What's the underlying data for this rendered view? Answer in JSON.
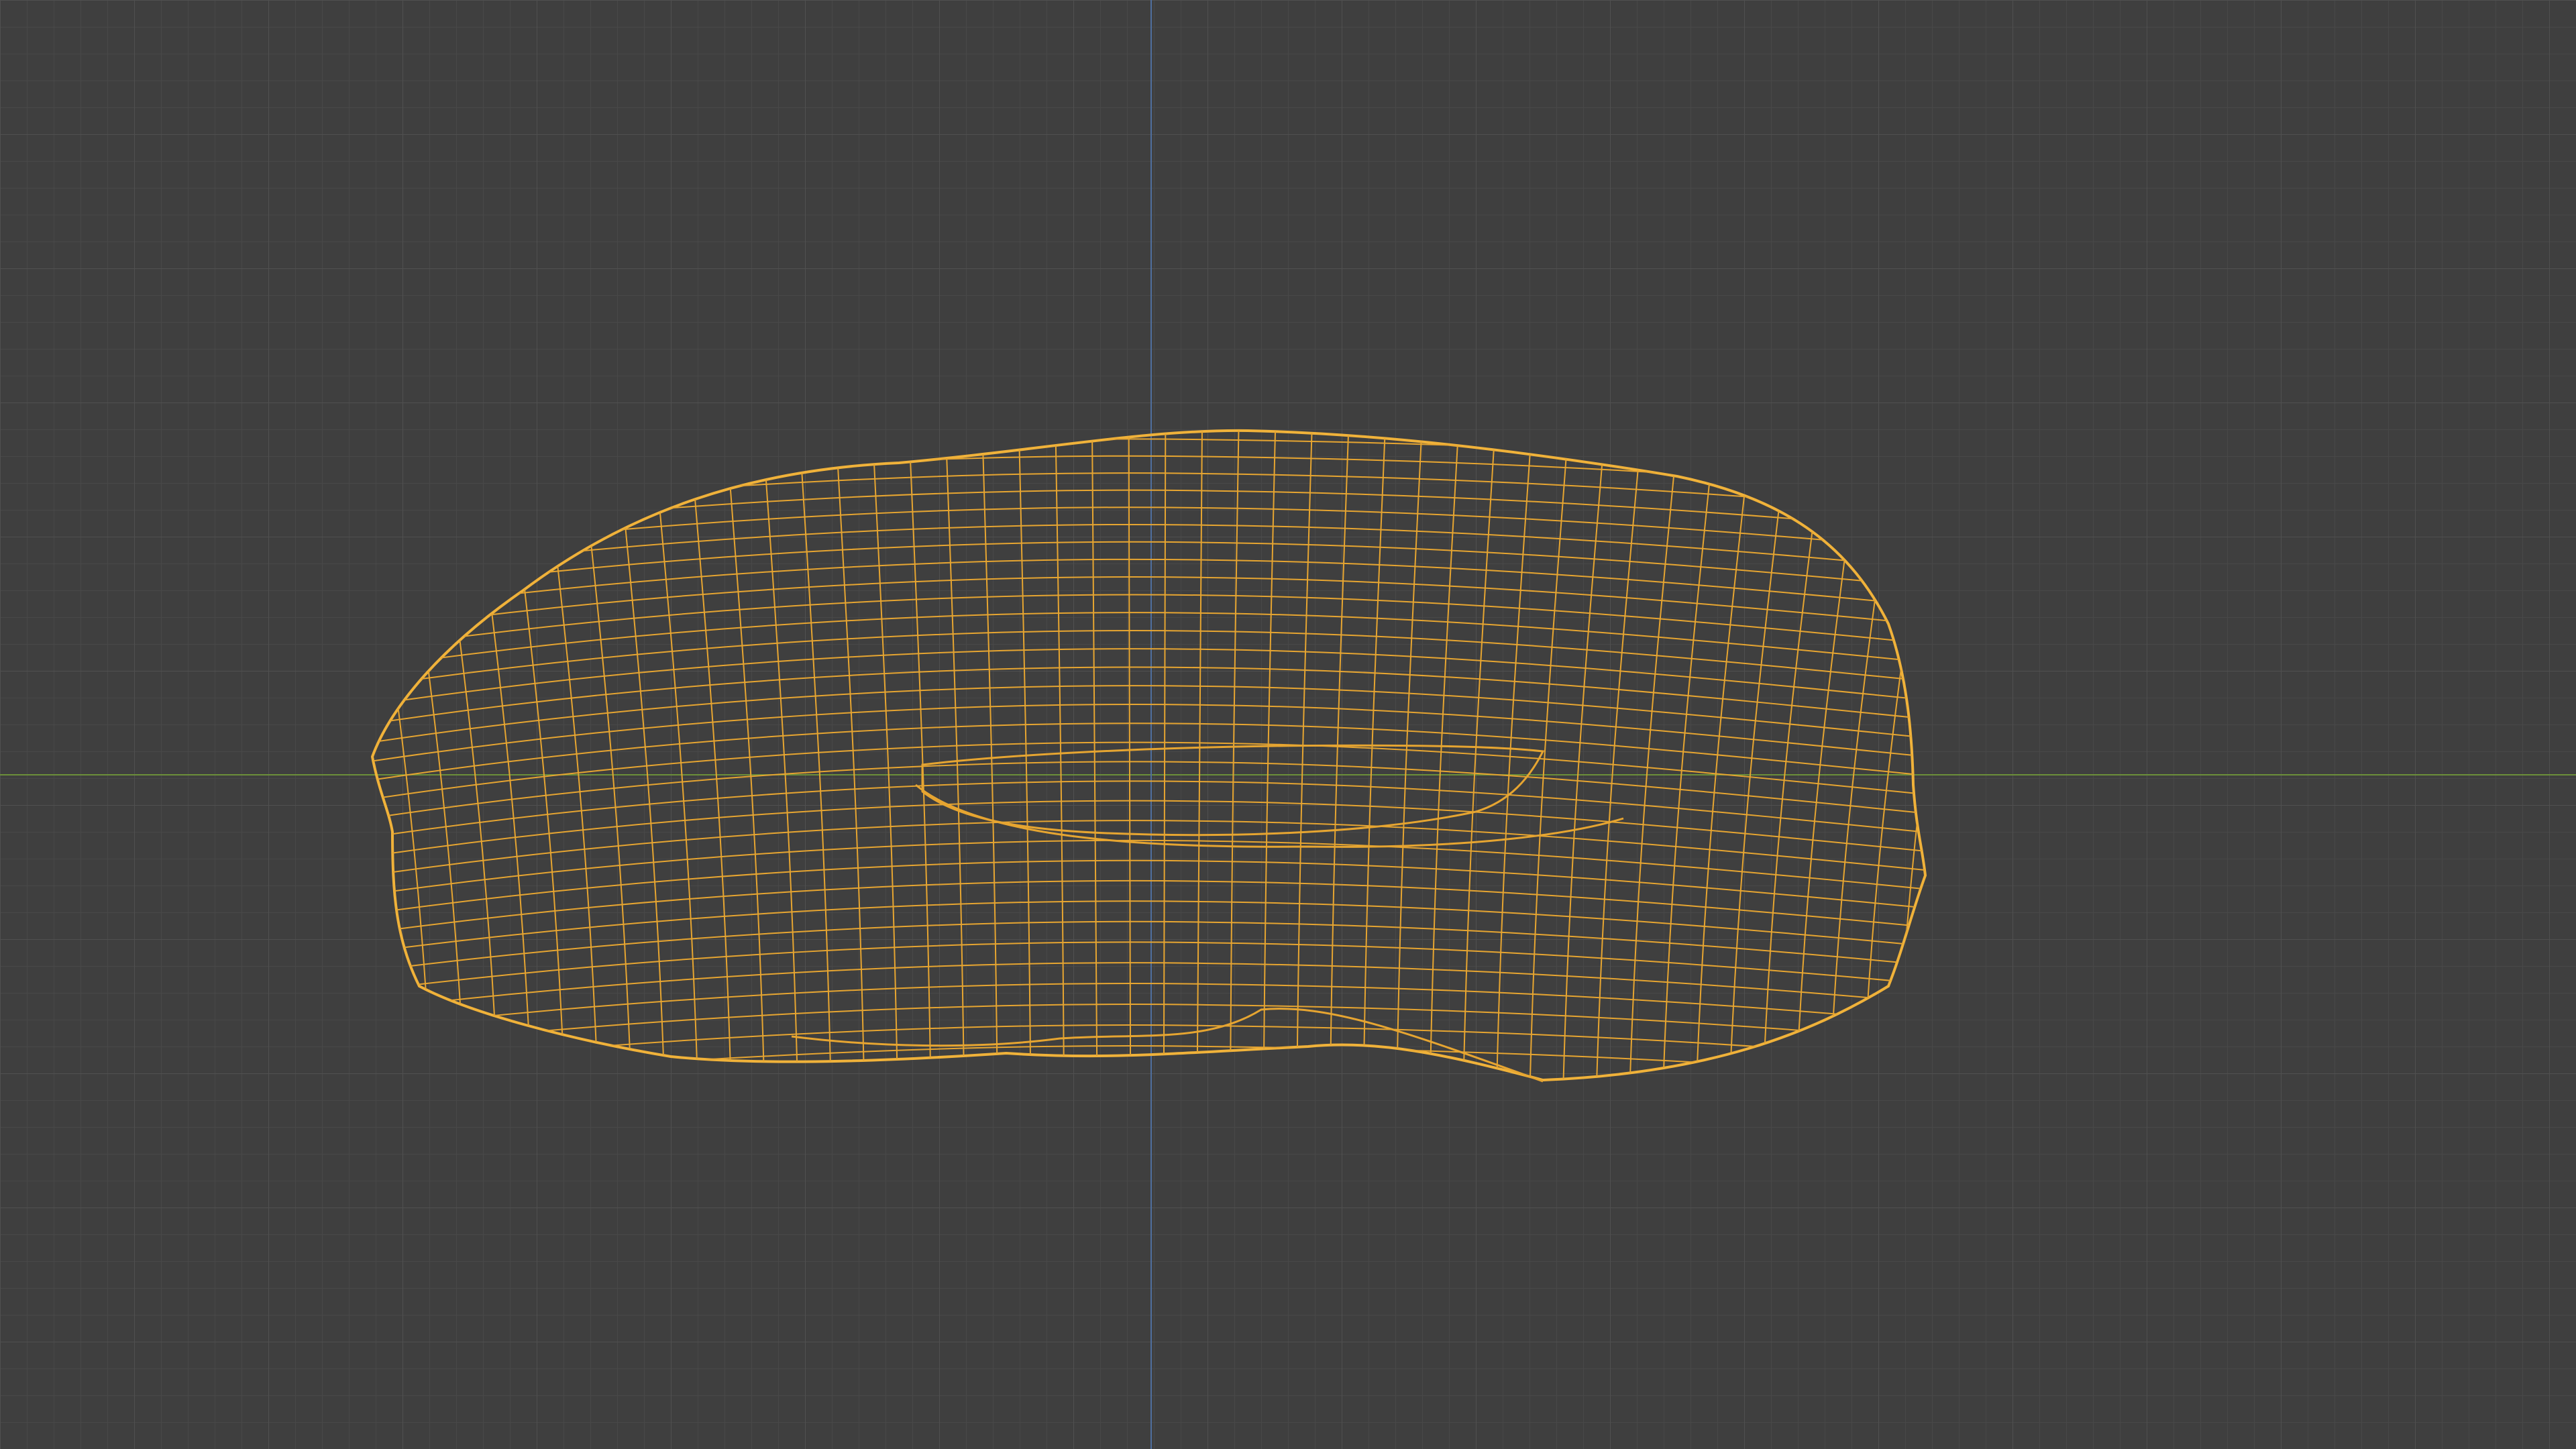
{
  "viewport": {
    "view": "3D viewport",
    "display_mode": "wireframe",
    "object_selected": true,
    "grid_visible": true,
    "axes_visible": [
      "x",
      "z"
    ]
  },
  "colors": {
    "background": "#3f3f3f",
    "grid_minor": "#484848",
    "grid_major": "#505050",
    "axis_x": "#6b8f3a",
    "axis_z": "#4f6f9f",
    "wireframe_selected": "#e6a531",
    "wireframe_outline": "#f0b23a"
  },
  "object": {
    "shape": "flattened torus-like mesh",
    "wireframe_state": "selected"
  }
}
